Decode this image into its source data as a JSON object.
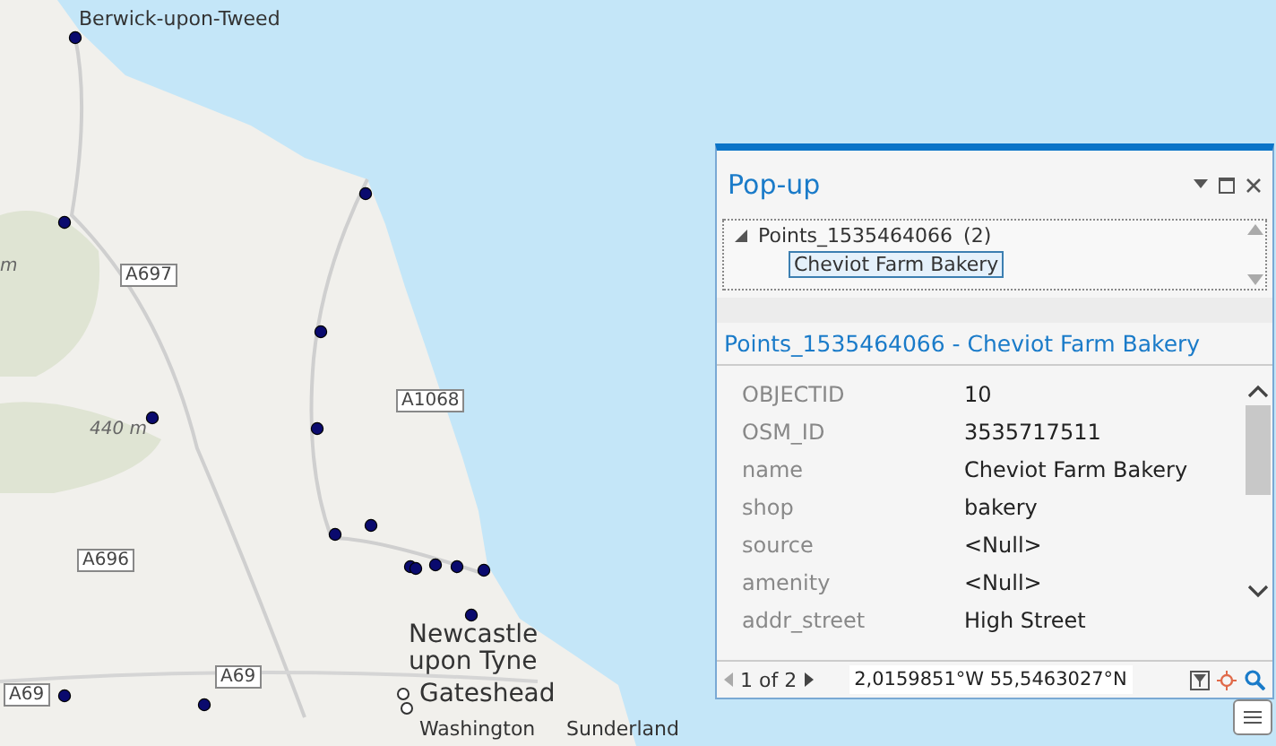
{
  "map": {
    "place_labels": [
      "Berwick-upon-Tweed",
      "Newcastle upon Tyne",
      "Gateshead",
      "Washington",
      "Sunderland"
    ],
    "road_labels": [
      "A697",
      "A1068",
      "A696",
      "A69",
      "A69"
    ],
    "elevation_labels": [
      "m",
      "440 m"
    ]
  },
  "popup": {
    "title": "Pop-up",
    "tree": {
      "layer": "Points_1535464066",
      "count": "(2)",
      "expanded": true,
      "features": [
        {
          "label": "Cheviot Farm Bakery",
          "selected": true
        }
      ]
    },
    "feature_title": "Points_1535464066 - Cheviot Farm Bakery",
    "attributes": [
      {
        "field": "OBJECTID",
        "value": "10"
      },
      {
        "field": "OSM_ID",
        "value": "3535717511"
      },
      {
        "field": "name",
        "value": "Cheviot Farm Bakery"
      },
      {
        "field": "shop",
        "value": "bakery"
      },
      {
        "field": "source",
        "value": "<Null>"
      },
      {
        "field": "amenity",
        "value": "<Null>"
      },
      {
        "field": "addr_street",
        "value": "High Street"
      }
    ],
    "pager": "1 of 2",
    "coordinates": "2,0159851°W 55,5463027°N"
  }
}
